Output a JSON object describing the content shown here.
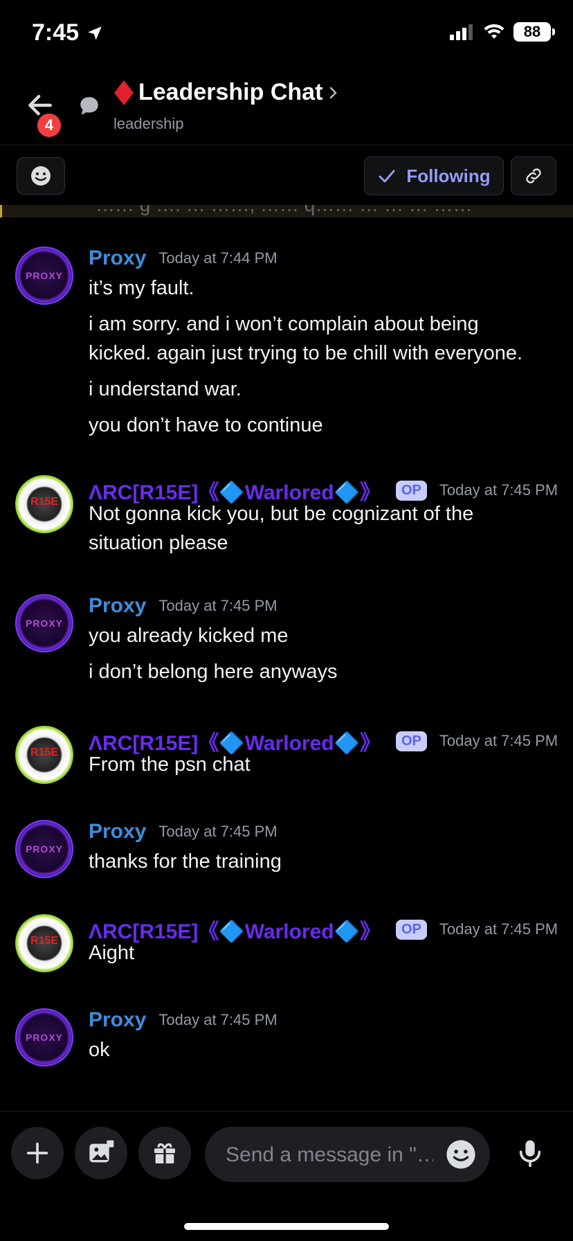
{
  "status": {
    "time": "7:45",
    "battery": "88"
  },
  "header": {
    "unread_badge": "4",
    "title": "Leadership Chat",
    "channel": "leadership"
  },
  "toolbar": {
    "following_label": "Following"
  },
  "cutoff_text": "…… g …. … ……, …… q…… … … … ……",
  "messages": [
    {
      "author": "Proxy",
      "time": "Today at 7:44 PM",
      "lines": [
        "it’s my fault.",
        "i am sorry. and i won’t complain about being",
        "kicked. again just trying to be chill with everyone.",
        "i understand war.",
        "you don’t have to continue"
      ]
    },
    {
      "author": "ΛRC[R15E]《🔷Warlored🔷》",
      "op": "OP",
      "time": "Today at 7:45 PM",
      "lines": [
        "Not gonna kick you, but be cognizant of the",
        "situation please"
      ]
    },
    {
      "author": "Proxy",
      "time": "Today at 7:45 PM",
      "lines": [
        "you already kicked me",
        "i don’t belong here anyways"
      ]
    },
    {
      "author": "ΛRC[R15E]《🔷Warlored🔷》",
      "op": "OP",
      "time": "Today at 7:45 PM",
      "lines": [
        "From the psn chat"
      ]
    },
    {
      "author": "Proxy",
      "time": "Today at 7:45 PM",
      "lines": [
        "thanks for the training"
      ]
    },
    {
      "author": "ΛRC[R15E]《🔷Warlored🔷》",
      "op": "OP",
      "time": "Today at 7:45 PM",
      "lines": [
        "Aight"
      ]
    },
    {
      "author": "Proxy",
      "time": "Today at 7:45 PM",
      "lines": [
        "ok"
      ]
    }
  ],
  "avatars": {
    "proxy_text": "PROXY",
    "arc_text": "R15E"
  },
  "composer": {
    "placeholder": "Send a message in \"…"
  },
  "colors": {
    "accent": "#5865f2",
    "proxy_name": "#3b8fdf",
    "arc_name": "#6a2bf0",
    "badge": "#f23f42"
  },
  "icons": [
    "location-arrow-icon",
    "signal-icon",
    "wifi-icon",
    "back-arrow-icon",
    "thread-icon",
    "diamond-icon",
    "chevron-right-icon",
    "emoji-icon",
    "check-icon",
    "link-icon",
    "plus-icon",
    "image-icon",
    "gift-icon",
    "mic-icon"
  ]
}
